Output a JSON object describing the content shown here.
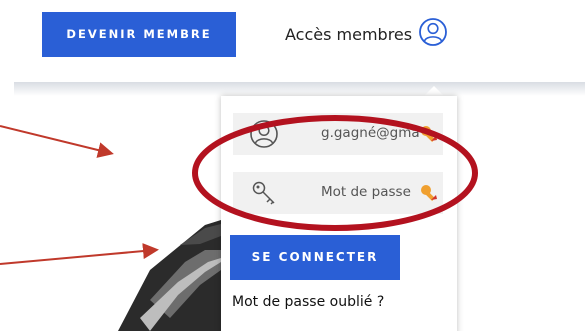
{
  "header": {
    "join_button_label": "DEVENIR MEMBRE",
    "members_access_label": "Accès membres"
  },
  "login": {
    "email_value": "g.gagné@gma",
    "password_placeholder": "Mot de passe",
    "connect_button_label": "SE CONNECTER",
    "forgot_password_label": "Mot de passe oublié ?"
  },
  "icons": {
    "members": "user-circle-icon",
    "email_field": "user-icon",
    "password_field": "key-icon",
    "autofill": "key-autofill-icon"
  },
  "colors": {
    "primary": "#2a5fd6",
    "annotation": "#c0392b",
    "field_bg": "#f1f1f1"
  }
}
